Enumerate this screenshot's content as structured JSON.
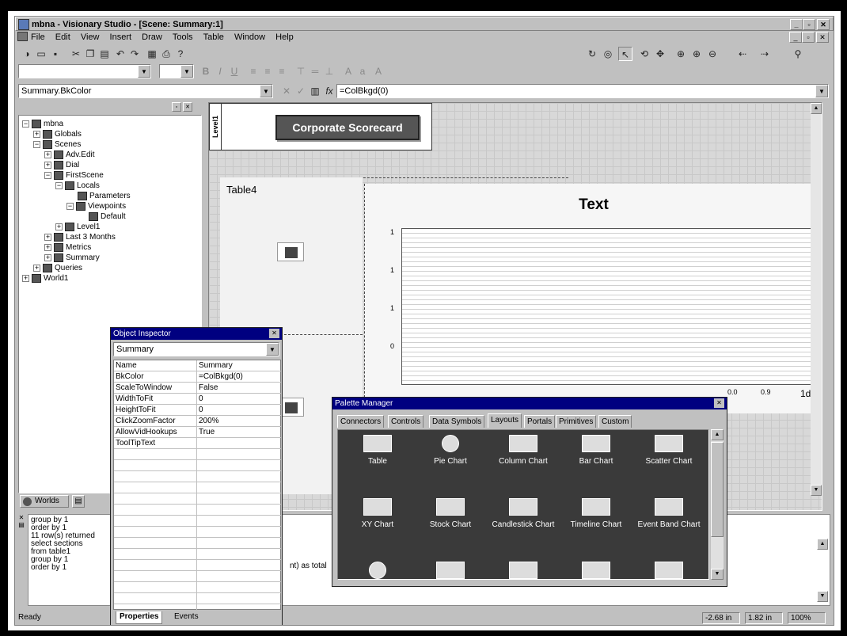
{
  "window": {
    "title": "mbna - Visionary Studio - [Scene: Summary:1]"
  },
  "menu": [
    "File",
    "Edit",
    "View",
    "Insert",
    "Draw",
    "Tools",
    "Table",
    "Window",
    "Help"
  ],
  "formula": {
    "name": "Summary.BkColor",
    "value": "=ColBkgd(0)"
  },
  "tree": {
    "items": [
      {
        "label": "mbna",
        "depth": 0
      },
      {
        "label": "Globals",
        "depth": 1
      },
      {
        "label": "Scenes",
        "depth": 1
      },
      {
        "label": "Adv.Edit",
        "depth": 2
      },
      {
        "label": "Dial",
        "depth": 2
      },
      {
        "label": "FirstScene",
        "depth": 2
      },
      {
        "label": "Locals",
        "depth": 3
      },
      {
        "label": "Parameters",
        "depth": 4
      },
      {
        "label": "Viewpoints",
        "depth": 4
      },
      {
        "label": "Default",
        "depth": 5
      },
      {
        "label": "Level1",
        "depth": 3
      },
      {
        "label": "Last 3 Months",
        "depth": 2
      },
      {
        "label": "Metrics",
        "depth": 2
      },
      {
        "label": "Summary",
        "depth": 2
      },
      {
        "label": "Queries",
        "depth": 1
      },
      {
        "label": "World1",
        "depth": 0
      }
    ],
    "bottom_tab": "Worlds"
  },
  "scene": {
    "level_tab": "Level1",
    "button": "Corporate Scorecard",
    "table_label": "Table4",
    "chart_title": "Text",
    "y_ticks": [
      "1",
      "1",
      "1",
      "0"
    ],
    "x_ticks": [
      "0.0",
      "0.9",
      "1d"
    ]
  },
  "object_inspector": {
    "title": "Object Inspector",
    "selected": "Summary",
    "rows": [
      {
        "key": "Name",
        "value": "Summary"
      },
      {
        "key": "BkColor",
        "value": "=ColBkgd(0)"
      },
      {
        "key": "ScaleToWindow",
        "value": "False"
      },
      {
        "key": "WidthToFit",
        "value": "0"
      },
      {
        "key": "HeightToFit",
        "value": "0"
      },
      {
        "key": "ClickZoomFactor",
        "value": "200%"
      },
      {
        "key": "AllowVidHookups",
        "value": "True"
      },
      {
        "key": "ToolTipText",
        "value": ""
      }
    ],
    "tabs": [
      "Properties",
      "Events"
    ]
  },
  "palette": {
    "title": "Palette Manager",
    "tabs": [
      "Connectors",
      "Controls",
      "Data Symbols",
      "Layouts",
      "Portals",
      "Primitives",
      "Custom"
    ],
    "active_tab": "Layouts",
    "items": [
      "Table",
      "Pie Chart",
      "Column Chart",
      "Bar Chart",
      "Scatter Chart",
      "XY Chart",
      "Stock Chart",
      "Candlestick Chart",
      "Timeline Chart",
      "Event Band Chart"
    ]
  },
  "output": {
    "lines": [
      "group by 1",
      "order by 1",
      "11 row(s) returned",
      "select sections",
      "  from table1",
      "group by 1",
      "order by 1"
    ],
    "fragment": "nt) as total"
  },
  "status": {
    "text": "Ready",
    "x": "-2.68 in",
    "y": "1.82 in",
    "zoom": "100%"
  }
}
